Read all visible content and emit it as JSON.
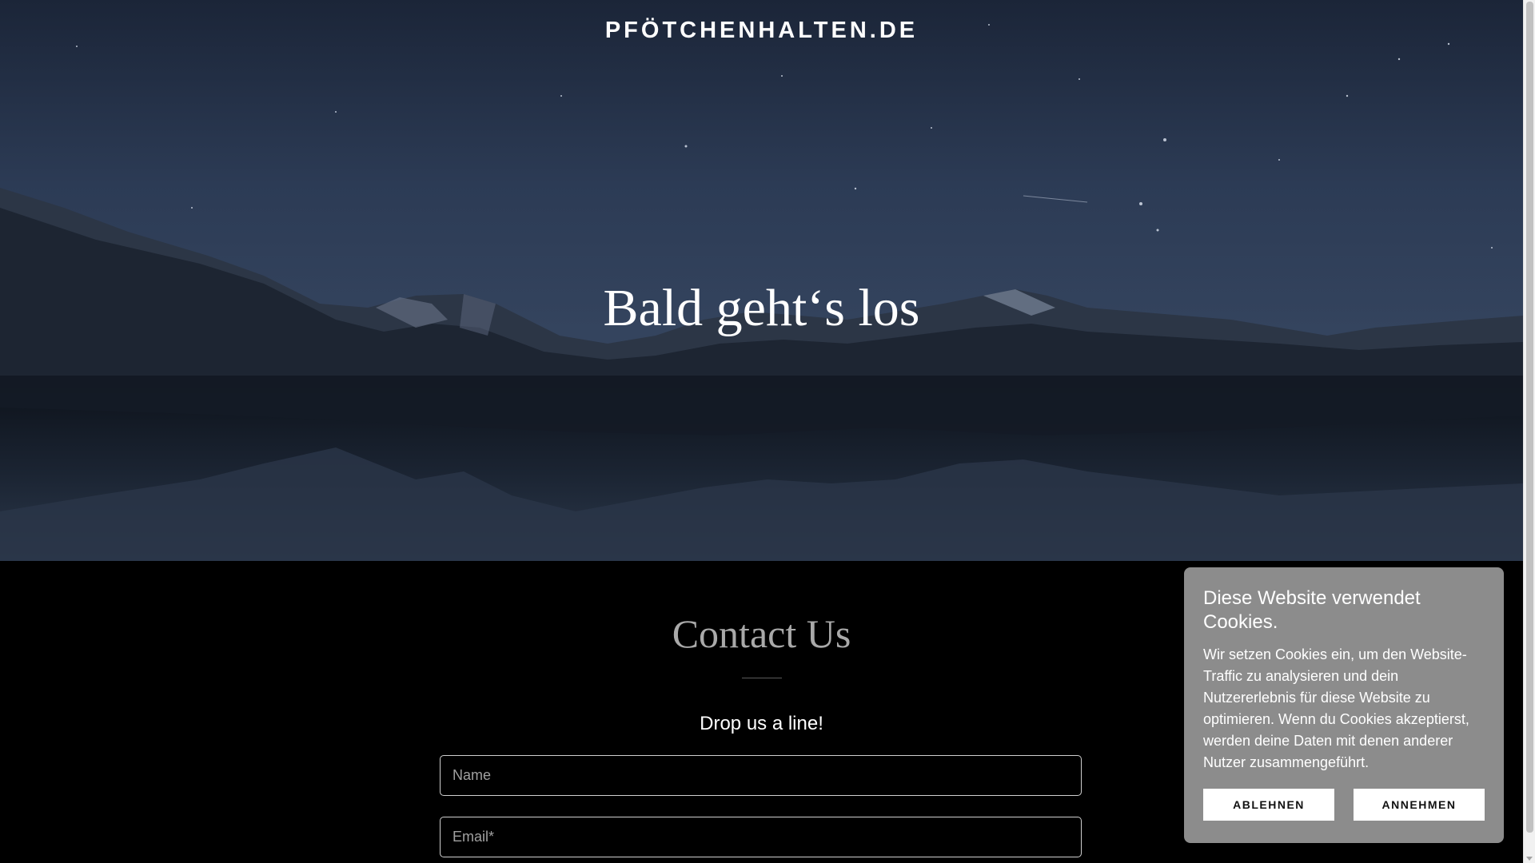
{
  "header": {
    "site_title": "PFÖTCHENHALTEN.DE"
  },
  "hero": {
    "heading": "Bald geht‘s los",
    "background": "night-sky-mountains-lake-image"
  },
  "contact": {
    "title": "Contact Us",
    "subtitle": "Drop us a line!",
    "fields": {
      "name_placeholder": "Name",
      "email_placeholder": "Email*"
    }
  },
  "cookie_banner": {
    "title": "Diese Website verwendet Cookies.",
    "text": "Wir setzen Cookies ein, um den Website-Traffic zu analysieren und dein Nutzererlebnis für diese Website zu optimieren. Wenn du Cookies akzeptierst, werden deine Daten mit denen anderer Nutzer zusammengeführt.",
    "decline_label": "ABLEHNEN",
    "accept_label": "ANNEHMEN",
    "background_color": "#8c8c8c"
  },
  "colors": {
    "page_background": "#000000",
    "contact_title": "#a9a9a9",
    "text": "#ffffff"
  }
}
